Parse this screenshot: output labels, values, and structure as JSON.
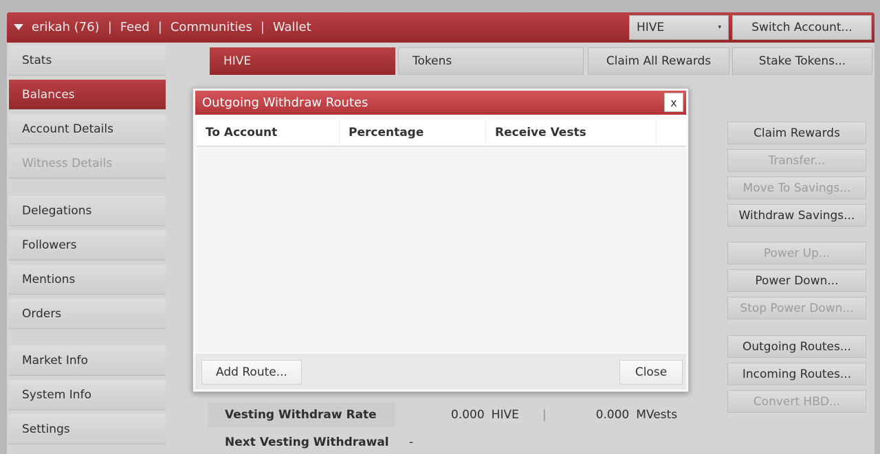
{
  "topbar": {
    "user": "erikah (76)",
    "nav": [
      "Feed",
      "Communities",
      "Wallet"
    ],
    "separator": "|",
    "coin_selected": "HIVE",
    "caret": "▾",
    "switch_account": "Switch Account..."
  },
  "sidebar": {
    "items": [
      {
        "label": "Stats"
      },
      {
        "label": "Balances"
      },
      {
        "label": "Account Details"
      },
      {
        "label": "Witness Details"
      },
      {
        "label": "Delegations"
      },
      {
        "label": "Followers"
      },
      {
        "label": "Mentions"
      },
      {
        "label": "Orders"
      },
      {
        "label": "Market Info"
      },
      {
        "label": "System Info"
      },
      {
        "label": "Settings"
      }
    ]
  },
  "main": {
    "tabs": [
      "HIVE",
      "Tokens"
    ],
    "claim_all": "Claim All Rewards",
    "stake_tokens": "Stake Tokens...",
    "right_buttons": [
      {
        "label": "Claim Rewards"
      },
      {
        "label": "Transfer..."
      },
      {
        "label": "Move To Savings..."
      },
      {
        "label": "Withdraw Savings..."
      },
      {
        "label": "Power Up..."
      },
      {
        "label": "Power Down..."
      },
      {
        "label": "Stop Power Down..."
      },
      {
        "label": "Outgoing Routes..."
      },
      {
        "label": "Incoming Routes..."
      },
      {
        "label": "Convert HBD..."
      }
    ],
    "vesting_rate": {
      "label": "Vesting Withdraw Rate",
      "hive_value": "0.000",
      "hive_unit": "HIVE",
      "divider": "|",
      "mvests_value": "0.000",
      "mvests_unit": "MVests"
    },
    "next_withdrawal": {
      "label": "Next Vesting Withdrawal",
      "value": "-"
    }
  },
  "dialog": {
    "title": "Outgoing Withdraw Routes",
    "close_x": "x",
    "columns": [
      "To Account",
      "Percentage",
      "Receive Vests"
    ],
    "add_route": "Add Route...",
    "close": "Close"
  }
}
